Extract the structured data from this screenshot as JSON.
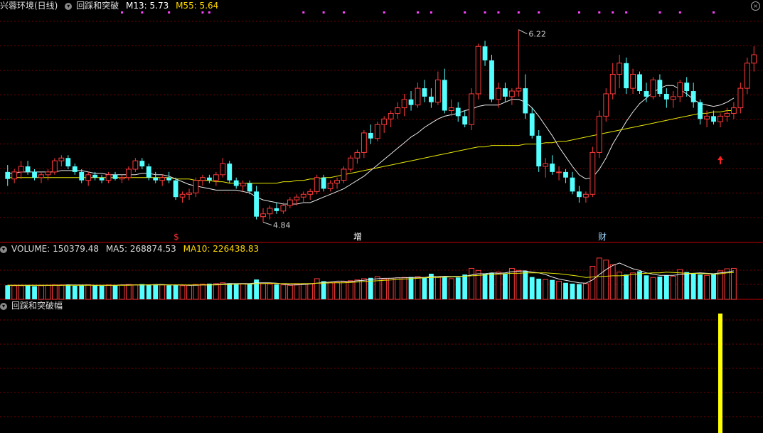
{
  "header": {
    "stock_name": "兴蓉环境(日线)",
    "indicator_name": "回踩和突破",
    "m13_label": "M13: 5.73",
    "m55_label": "M55: 5.64"
  },
  "volume_header": {
    "volume_label": "VOLUME: 150379.48",
    "ma5_label": "MA5: 268874.53",
    "ma10_label": "MA10: 226438.83"
  },
  "indicator_header": {
    "name": "回踩和突破幅"
  },
  "annotations": {
    "high_price": "6.22",
    "low_price": "4.84"
  },
  "event_markers": [
    {
      "label": "$",
      "color": "#ff3030"
    },
    {
      "label": "增",
      "color": "#ffffff"
    },
    {
      "label": "财",
      "color": "#9ad6ff"
    }
  ],
  "colors": {
    "up": "#ff3a3a",
    "down": "#54ffff",
    "ma_short": "#e8e8e8",
    "ma_long": "#e8e800",
    "grid": "#7a0000",
    "signal_bar": "#ffff00",
    "arrow": "#ff2020",
    "top_dot": "#ff40ff"
  },
  "chart_data": {
    "type": "candlestick",
    "candles": [
      {
        "o": 5.2,
        "h": 5.25,
        "l": 5.1,
        "c": 5.15
      },
      {
        "o": 5.15,
        "h": 5.22,
        "l": 5.12,
        "c": 5.2
      },
      {
        "o": 5.2,
        "h": 5.28,
        "l": 5.15,
        "c": 5.24
      },
      {
        "o": 5.24,
        "h": 5.28,
        "l": 5.18,
        "c": 5.2
      },
      {
        "o": 5.2,
        "h": 5.22,
        "l": 5.14,
        "c": 5.16
      },
      {
        "o": 5.16,
        "h": 5.2,
        "l": 5.12,
        "c": 5.18
      },
      {
        "o": 5.18,
        "h": 5.22,
        "l": 5.14,
        "c": 5.2
      },
      {
        "o": 5.2,
        "h": 5.3,
        "l": 5.18,
        "c": 5.28
      },
      {
        "o": 5.28,
        "h": 5.32,
        "l": 5.24,
        "c": 5.3
      },
      {
        "o": 5.3,
        "h": 5.32,
        "l": 5.22,
        "c": 5.24
      },
      {
        "o": 5.24,
        "h": 5.26,
        "l": 5.18,
        "c": 5.2
      },
      {
        "o": 5.2,
        "h": 5.22,
        "l": 5.12,
        "c": 5.14
      },
      {
        "o": 5.14,
        "h": 5.2,
        "l": 5.1,
        "c": 5.18
      },
      {
        "o": 5.18,
        "h": 5.2,
        "l": 5.14,
        "c": 5.16
      },
      {
        "o": 5.16,
        "h": 5.18,
        "l": 5.12,
        "c": 5.14
      },
      {
        "o": 5.14,
        "h": 5.2,
        "l": 5.12,
        "c": 5.18
      },
      {
        "o": 5.18,
        "h": 5.2,
        "l": 5.14,
        "c": 5.15
      },
      {
        "o": 5.15,
        "h": 5.18,
        "l": 5.12,
        "c": 5.16
      },
      {
        "o": 5.16,
        "h": 5.24,
        "l": 5.14,
        "c": 5.22
      },
      {
        "o": 5.22,
        "h": 5.3,
        "l": 5.2,
        "c": 5.28
      },
      {
        "o": 5.28,
        "h": 5.3,
        "l": 5.22,
        "c": 5.24
      },
      {
        "o": 5.24,
        "h": 5.26,
        "l": 5.14,
        "c": 5.16
      },
      {
        "o": 5.16,
        "h": 5.2,
        "l": 5.12,
        "c": 5.14
      },
      {
        "o": 5.14,
        "h": 5.18,
        "l": 5.1,
        "c": 5.16
      },
      {
        "o": 5.16,
        "h": 5.2,
        "l": 5.12,
        "c": 5.14
      },
      {
        "o": 5.14,
        "h": 5.16,
        "l": 5.0,
        "c": 5.02
      },
      {
        "o": 5.02,
        "h": 5.06,
        "l": 4.98,
        "c": 5.04
      },
      {
        "o": 5.04,
        "h": 5.08,
        "l": 5.0,
        "c": 5.05
      },
      {
        "o": 5.05,
        "h": 5.16,
        "l": 5.02,
        "c": 5.14
      },
      {
        "o": 5.14,
        "h": 5.18,
        "l": 5.1,
        "c": 5.16
      },
      {
        "o": 5.16,
        "h": 5.18,
        "l": 5.12,
        "c": 5.14
      },
      {
        "o": 5.14,
        "h": 5.2,
        "l": 5.1,
        "c": 5.18
      },
      {
        "o": 5.18,
        "h": 5.3,
        "l": 5.16,
        "c": 5.26
      },
      {
        "o": 5.26,
        "h": 5.28,
        "l": 5.12,
        "c": 5.14
      },
      {
        "o": 5.14,
        "h": 5.16,
        "l": 5.08,
        "c": 5.1
      },
      {
        "o": 5.1,
        "h": 5.14,
        "l": 5.06,
        "c": 5.12
      },
      {
        "o": 5.12,
        "h": 5.14,
        "l": 5.04,
        "c": 5.06
      },
      {
        "o": 5.06,
        "h": 5.1,
        "l": 4.86,
        "c": 4.88
      },
      {
        "o": 4.88,
        "h": 4.94,
        "l": 4.84,
        "c": 4.9
      },
      {
        "o": 4.9,
        "h": 4.96,
        "l": 4.86,
        "c": 4.94
      },
      {
        "o": 4.94,
        "h": 4.98,
        "l": 4.9,
        "c": 4.92
      },
      {
        "o": 4.92,
        "h": 4.98,
        "l": 4.9,
        "c": 4.96
      },
      {
        "o": 4.96,
        "h": 5.02,
        "l": 4.94,
        "c": 5.0
      },
      {
        "o": 5.0,
        "h": 5.04,
        "l": 4.96,
        "c": 5.02
      },
      {
        "o": 5.02,
        "h": 5.06,
        "l": 4.98,
        "c": 5.04
      },
      {
        "o": 5.04,
        "h": 5.08,
        "l": 5.0,
        "c": 5.06
      },
      {
        "o": 5.06,
        "h": 5.18,
        "l": 5.04,
        "c": 5.16
      },
      {
        "o": 5.16,
        "h": 5.18,
        "l": 5.06,
        "c": 5.08
      },
      {
        "o": 5.08,
        "h": 5.14,
        "l": 5.06,
        "c": 5.12
      },
      {
        "o": 5.12,
        "h": 5.16,
        "l": 5.08,
        "c": 5.14
      },
      {
        "o": 5.14,
        "h": 5.24,
        "l": 5.12,
        "c": 5.22
      },
      {
        "o": 5.22,
        "h": 5.32,
        "l": 5.2,
        "c": 5.3
      },
      {
        "o": 5.3,
        "h": 5.36,
        "l": 5.26,
        "c": 5.34
      },
      {
        "o": 5.34,
        "h": 5.5,
        "l": 5.3,
        "c": 5.48
      },
      {
        "o": 5.48,
        "h": 5.54,
        "l": 5.4,
        "c": 5.44
      },
      {
        "o": 5.44,
        "h": 5.56,
        "l": 5.42,
        "c": 5.54
      },
      {
        "o": 5.54,
        "h": 5.6,
        "l": 5.48,
        "c": 5.58
      },
      {
        "o": 5.58,
        "h": 5.64,
        "l": 5.52,
        "c": 5.62
      },
      {
        "o": 5.62,
        "h": 5.7,
        "l": 5.58,
        "c": 5.66
      },
      {
        "o": 5.66,
        "h": 5.76,
        "l": 5.6,
        "c": 5.72
      },
      {
        "o": 5.72,
        "h": 5.78,
        "l": 5.64,
        "c": 5.68
      },
      {
        "o": 5.68,
        "h": 5.84,
        "l": 5.66,
        "c": 5.8
      },
      {
        "o": 5.8,
        "h": 5.86,
        "l": 5.7,
        "c": 5.74
      },
      {
        "o": 5.74,
        "h": 5.8,
        "l": 5.66,
        "c": 5.7
      },
      {
        "o": 5.7,
        "h": 5.92,
        "l": 5.68,
        "c": 5.86
      },
      {
        "o": 5.86,
        "h": 5.94,
        "l": 5.62,
        "c": 5.64
      },
      {
        "o": 5.64,
        "h": 5.72,
        "l": 5.6,
        "c": 5.66
      },
      {
        "o": 5.66,
        "h": 5.7,
        "l": 5.56,
        "c": 5.6
      },
      {
        "o": 5.6,
        "h": 5.64,
        "l": 5.52,
        "c": 5.54
      },
      {
        "o": 5.54,
        "h": 5.8,
        "l": 5.5,
        "c": 5.76
      },
      {
        "o": 5.76,
        "h": 6.12,
        "l": 5.72,
        "c": 6.1
      },
      {
        "o": 6.1,
        "h": 6.14,
        "l": 5.96,
        "c": 6.0
      },
      {
        "o": 6.0,
        "h": 6.04,
        "l": 5.7,
        "c": 5.72
      },
      {
        "o": 5.72,
        "h": 5.84,
        "l": 5.66,
        "c": 5.8
      },
      {
        "o": 5.8,
        "h": 5.84,
        "l": 5.7,
        "c": 5.74
      },
      {
        "o": 5.74,
        "h": 5.8,
        "l": 5.68,
        "c": 5.78
      },
      {
        "o": 5.78,
        "h": 6.22,
        "l": 5.74,
        "c": 5.8
      },
      {
        "o": 5.8,
        "h": 5.9,
        "l": 5.58,
        "c": 5.62
      },
      {
        "o": 5.62,
        "h": 5.66,
        "l": 5.44,
        "c": 5.46
      },
      {
        "o": 5.46,
        "h": 5.5,
        "l": 5.2,
        "c": 5.24
      },
      {
        "o": 5.24,
        "h": 5.3,
        "l": 5.16,
        "c": 5.26
      },
      {
        "o": 5.26,
        "h": 5.32,
        "l": 5.18,
        "c": 5.2
      },
      {
        "o": 5.2,
        "h": 5.24,
        "l": 5.14,
        "c": 5.2
      },
      {
        "o": 5.2,
        "h": 5.22,
        "l": 5.12,
        "c": 5.16
      },
      {
        "o": 5.16,
        "h": 5.2,
        "l": 5.04,
        "c": 5.06
      },
      {
        "o": 5.06,
        "h": 5.1,
        "l": 4.98,
        "c": 5.02
      },
      {
        "o": 5.02,
        "h": 5.06,
        "l": 4.98,
        "c": 5.04
      },
      {
        "o": 5.04,
        "h": 5.38,
        "l": 5.02,
        "c": 5.34
      },
      {
        "o": 5.34,
        "h": 5.64,
        "l": 5.3,
        "c": 5.6
      },
      {
        "o": 5.6,
        "h": 5.8,
        "l": 5.56,
        "c": 5.76
      },
      {
        "o": 5.76,
        "h": 5.98,
        "l": 5.72,
        "c": 5.9
      },
      {
        "o": 5.9,
        "h": 6.04,
        "l": 5.8,
        "c": 5.98
      },
      {
        "o": 5.98,
        "h": 6.02,
        "l": 5.76,
        "c": 5.8
      },
      {
        "o": 5.8,
        "h": 5.94,
        "l": 5.76,
        "c": 5.9
      },
      {
        "o": 5.9,
        "h": 5.92,
        "l": 5.76,
        "c": 5.78
      },
      {
        "o": 5.78,
        "h": 5.84,
        "l": 5.7,
        "c": 5.74
      },
      {
        "o": 5.74,
        "h": 5.88,
        "l": 5.72,
        "c": 5.86
      },
      {
        "o": 5.86,
        "h": 5.9,
        "l": 5.74,
        "c": 5.76
      },
      {
        "o": 5.76,
        "h": 5.8,
        "l": 5.66,
        "c": 5.72
      },
      {
        "o": 5.72,
        "h": 5.78,
        "l": 5.66,
        "c": 5.74
      },
      {
        "o": 5.74,
        "h": 5.86,
        "l": 5.7,
        "c": 5.84
      },
      {
        "o": 5.84,
        "h": 5.88,
        "l": 5.74,
        "c": 5.78
      },
      {
        "o": 5.78,
        "h": 5.84,
        "l": 5.66,
        "c": 5.7
      },
      {
        "o": 5.7,
        "h": 5.72,
        "l": 5.54,
        "c": 5.58
      },
      {
        "o": 5.58,
        "h": 5.64,
        "l": 5.52,
        "c": 5.6
      },
      {
        "o": 5.6,
        "h": 5.64,
        "l": 5.54,
        "c": 5.56
      },
      {
        "o": 5.56,
        "h": 5.62,
        "l": 5.52,
        "c": 5.6
      },
      {
        "o": 5.6,
        "h": 5.66,
        "l": 5.56,
        "c": 5.62
      },
      {
        "o": 5.62,
        "h": 5.7,
        "l": 5.58,
        "c": 5.66
      },
      {
        "o": 5.66,
        "h": 5.84,
        "l": 5.62,
        "c": 5.8
      },
      {
        "o": 5.8,
        "h": 6.02,
        "l": 5.76,
        "c": 5.98
      },
      {
        "o": 5.98,
        "h": 6.1,
        "l": 5.92,
        "c": 6.04
      }
    ],
    "ma13": [
      5.19,
      5.19,
      5.2,
      5.2,
      5.2,
      5.2,
      5.2,
      5.2,
      5.21,
      5.21,
      5.21,
      5.21,
      5.2,
      5.19,
      5.19,
      5.18,
      5.18,
      5.18,
      5.18,
      5.18,
      5.19,
      5.19,
      5.18,
      5.18,
      5.17,
      5.15,
      5.13,
      5.11,
      5.1,
      5.09,
      5.08,
      5.07,
      5.07,
      5.07,
      5.07,
      5.06,
      5.05,
      5.02,
      5.0,
      4.99,
      4.98,
      4.97,
      4.97,
      4.97,
      4.98,
      4.98,
      5.0,
      5.02,
      5.04,
      5.06,
      5.08,
      5.11,
      5.14,
      5.17,
      5.21,
      5.25,
      5.29,
      5.33,
      5.37,
      5.41,
      5.45,
      5.48,
      5.52,
      5.55,
      5.58,
      5.6,
      5.61,
      5.62,
      5.64,
      5.65,
      5.67,
      5.68,
      5.68,
      5.68,
      5.7,
      5.72,
      5.72,
      5.7,
      5.66,
      5.6,
      5.53,
      5.46,
      5.38,
      5.31,
      5.24,
      5.18,
      5.15,
      5.16,
      5.22,
      5.3,
      5.4,
      5.48,
      5.56,
      5.63,
      5.69,
      5.73,
      5.77,
      5.8,
      5.82,
      5.82,
      5.79,
      5.76,
      5.72,
      5.69,
      5.68,
      5.67,
      5.68,
      5.7,
      5.73
    ],
    "ma55": [
      5.16,
      5.16,
      5.16,
      5.16,
      5.16,
      5.16,
      5.16,
      5.16,
      5.16,
      5.16,
      5.16,
      5.16,
      5.16,
      5.16,
      5.16,
      5.16,
      5.16,
      5.16,
      5.16,
      5.16,
      5.16,
      5.16,
      5.16,
      5.16,
      5.16,
      5.15,
      5.15,
      5.15,
      5.14,
      5.14,
      5.14,
      5.13,
      5.13,
      5.12,
      5.12,
      5.12,
      5.12,
      5.12,
      5.12,
      5.12,
      5.12,
      5.13,
      5.13,
      5.14,
      5.14,
      5.15,
      5.15,
      5.16,
      5.16,
      5.17,
      5.18,
      5.19,
      5.2,
      5.21,
      5.22,
      5.23,
      5.24,
      5.25,
      5.26,
      5.27,
      5.28,
      5.29,
      5.3,
      5.31,
      5.32,
      5.33,
      5.34,
      5.35,
      5.36,
      5.37,
      5.38,
      5.38,
      5.39,
      5.39,
      5.39,
      5.39,
      5.39,
      5.4,
      5.4,
      5.4,
      5.41,
      5.41,
      5.42,
      5.42,
      5.43,
      5.44,
      5.45,
      5.46,
      5.47,
      5.48,
      5.49,
      5.5,
      5.51,
      5.52,
      5.53,
      5.54,
      5.55,
      5.56,
      5.57,
      5.58,
      5.59,
      5.6,
      5.61,
      5.62,
      5.62,
      5.63,
      5.63,
      5.64,
      5.64
    ],
    "volume": [
      34,
      33,
      33,
      34,
      32,
      33,
      34,
      35,
      35,
      36,
      33,
      34,
      35,
      34,
      33,
      35,
      34,
      35,
      36,
      35,
      37,
      36,
      35,
      35,
      34,
      35,
      33,
      34,
      36,
      37,
      38,
      38,
      40,
      39,
      38,
      38,
      37,
      48,
      38,
      37,
      36,
      35,
      34,
      36,
      37,
      38,
      50,
      44,
      40,
      41,
      43,
      45,
      47,
      50,
      52,
      55,
      49,
      51,
      52,
      53,
      54,
      55,
      52,
      62,
      55,
      54,
      50,
      53,
      60,
      75,
      70,
      62,
      64,
      66,
      62,
      75,
      70,
      68,
      54,
      50,
      48,
      47,
      44,
      40,
      38,
      37,
      38,
      80,
      100,
      95,
      84,
      66,
      60,
      64,
      68,
      58,
      53,
      55,
      58,
      56,
      72,
      66,
      62,
      60,
      58,
      62,
      69,
      74,
      75
    ],
    "vol_ma5": [
      34,
      34,
      34,
      34,
      34,
      34,
      34,
      34,
      34,
      35,
      35,
      35,
      35,
      34,
      34,
      34,
      34,
      35,
      35,
      35,
      35,
      35,
      36,
      36,
      35,
      35,
      35,
      34,
      34,
      35,
      35,
      36,
      37,
      38,
      38,
      38,
      38,
      40,
      40,
      40,
      39,
      37,
      35,
      35,
      36,
      37,
      39,
      41,
      42,
      44,
      44,
      43,
      45,
      46,
      48,
      50,
      51,
      51,
      52,
      52,
      53,
      53,
      53,
      55,
      55,
      56,
      55,
      56,
      56,
      59,
      62,
      62,
      64,
      63,
      64,
      67,
      68,
      69,
      66,
      64,
      60,
      54,
      49,
      46,
      43,
      40,
      39,
      47,
      60,
      72,
      82,
      88,
      81,
      74,
      70,
      64,
      61,
      58,
      58,
      58,
      60,
      61,
      63,
      64,
      63,
      62,
      64,
      66,
      69
    ],
    "vol_ma10": [
      34,
      34,
      34,
      34,
      34,
      34,
      34,
      34,
      34,
      34,
      34,
      34,
      34,
      34,
      34,
      34,
      34,
      34,
      34,
      35,
      35,
      35,
      35,
      35,
      35,
      35,
      35,
      35,
      35,
      35,
      35,
      35,
      36,
      36,
      37,
      37,
      37,
      38,
      38,
      39,
      38,
      38,
      38,
      38,
      38,
      38,
      39,
      39,
      40,
      40,
      40,
      41,
      42,
      43,
      44,
      45,
      46,
      47,
      48,
      49,
      50,
      51,
      52,
      53,
      53,
      54,
      54,
      55,
      56,
      57,
      58,
      59,
      60,
      61,
      62,
      63,
      63,
      64,
      64,
      64,
      64,
      63,
      62,
      60,
      58,
      56,
      53,
      54,
      55,
      56,
      57,
      57,
      58,
      60,
      62,
      63,
      64,
      64,
      66,
      65,
      64,
      63,
      63,
      62,
      62,
      61,
      62,
      64,
      65
    ],
    "signal": [
      0,
      0,
      0,
      0,
      0,
      0,
      0,
      0,
      0,
      0,
      0,
      0,
      0,
      0,
      0,
      0,
      0,
      0,
      0,
      0,
      0,
      0,
      0,
      0,
      0,
      0,
      0,
      0,
      0,
      0,
      0,
      0,
      0,
      0,
      0,
      0,
      0,
      0,
      0,
      0,
      0,
      0,
      0,
      0,
      0,
      0,
      0,
      0,
      0,
      0,
      0,
      0,
      0,
      0,
      0,
      0,
      0,
      0,
      0,
      0,
      0,
      0,
      0,
      0,
      0,
      0,
      0,
      0,
      0,
      0,
      0,
      0,
      0,
      0,
      0,
      0,
      0,
      0,
      0,
      0,
      0,
      0,
      0,
      0,
      0,
      0,
      0,
      0,
      0,
      0,
      0,
      0,
      0,
      0,
      0,
      0,
      0,
      0,
      0,
      0,
      0,
      0,
      0,
      0,
      0,
      0,
      1,
      0,
      0
    ],
    "price_range": [
      4.7,
      6.3
    ]
  }
}
